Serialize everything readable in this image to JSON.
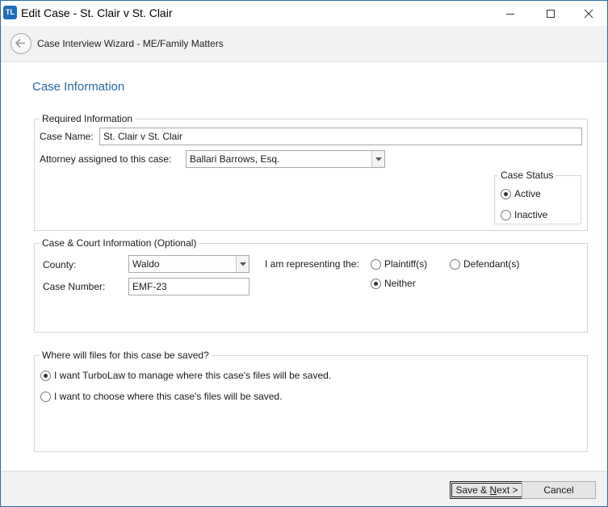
{
  "window": {
    "icon_text": "TL",
    "title": "Edit Case - St. Clair v St. Clair"
  },
  "wizard": {
    "title": "Case Interview Wizard - ME/Family Matters"
  },
  "page": {
    "heading": "Case Information"
  },
  "required": {
    "legend": "Required Information",
    "case_name_label": "Case Name:",
    "case_name_value": "St. Clair v St. Clair",
    "attorney_label": "Attorney assigned to this case:",
    "attorney_value": "Ballari Barrows, Esq.",
    "status": {
      "legend": "Case Status",
      "options": [
        {
          "label": "Active",
          "selected": true
        },
        {
          "label": "Inactive",
          "selected": false
        }
      ]
    }
  },
  "court": {
    "legend": "Case & Court Information (Optional)",
    "county_label": "County:",
    "county_value": "Waldo",
    "case_number_label": "Case Number:",
    "case_number_value": "EMF-23",
    "representing_label": "I am representing the:",
    "representing_options": [
      {
        "label": "Plaintiff(s)",
        "selected": false
      },
      {
        "label": "Defendant(s)",
        "selected": false
      },
      {
        "label": "Neither",
        "selected": true
      }
    ]
  },
  "files": {
    "legend": "Where will files for this case be saved?",
    "options": [
      {
        "label": "I want TurboLaw to manage where this case's files will be saved.",
        "selected": true
      },
      {
        "label": "I want to choose where this case's files will be saved.",
        "selected": false
      }
    ]
  },
  "footer": {
    "save_prefix": "Save & ",
    "save_access": "N",
    "save_suffix": "ext >",
    "cancel_label": "Cancel"
  }
}
